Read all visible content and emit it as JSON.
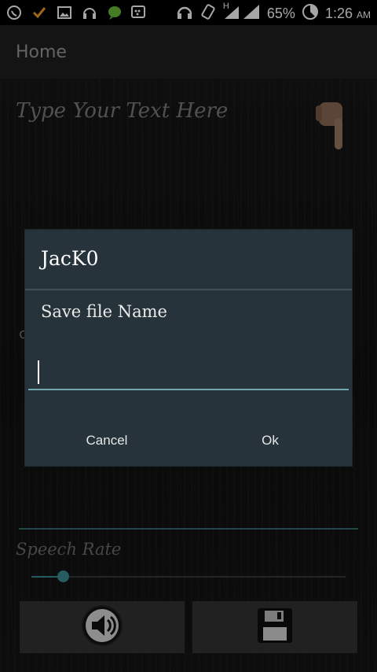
{
  "statusbar": {
    "battery": "65%",
    "time": "1:26",
    "ampm": "AM",
    "network": "H"
  },
  "actionbar": {
    "title": "Home"
  },
  "main": {
    "text_placeholder": "Type Your Text Here",
    "speech_rate_label": "Speech Rate",
    "speech_rate_value": 0.1
  },
  "dialog": {
    "title": "JacK0",
    "message": "Save file Name",
    "input_value": "",
    "cancel_label": "Cancel",
    "ok_label": "Ok"
  },
  "colors": {
    "accent": "#3c8e98",
    "dialog_bg": "#26333a"
  }
}
